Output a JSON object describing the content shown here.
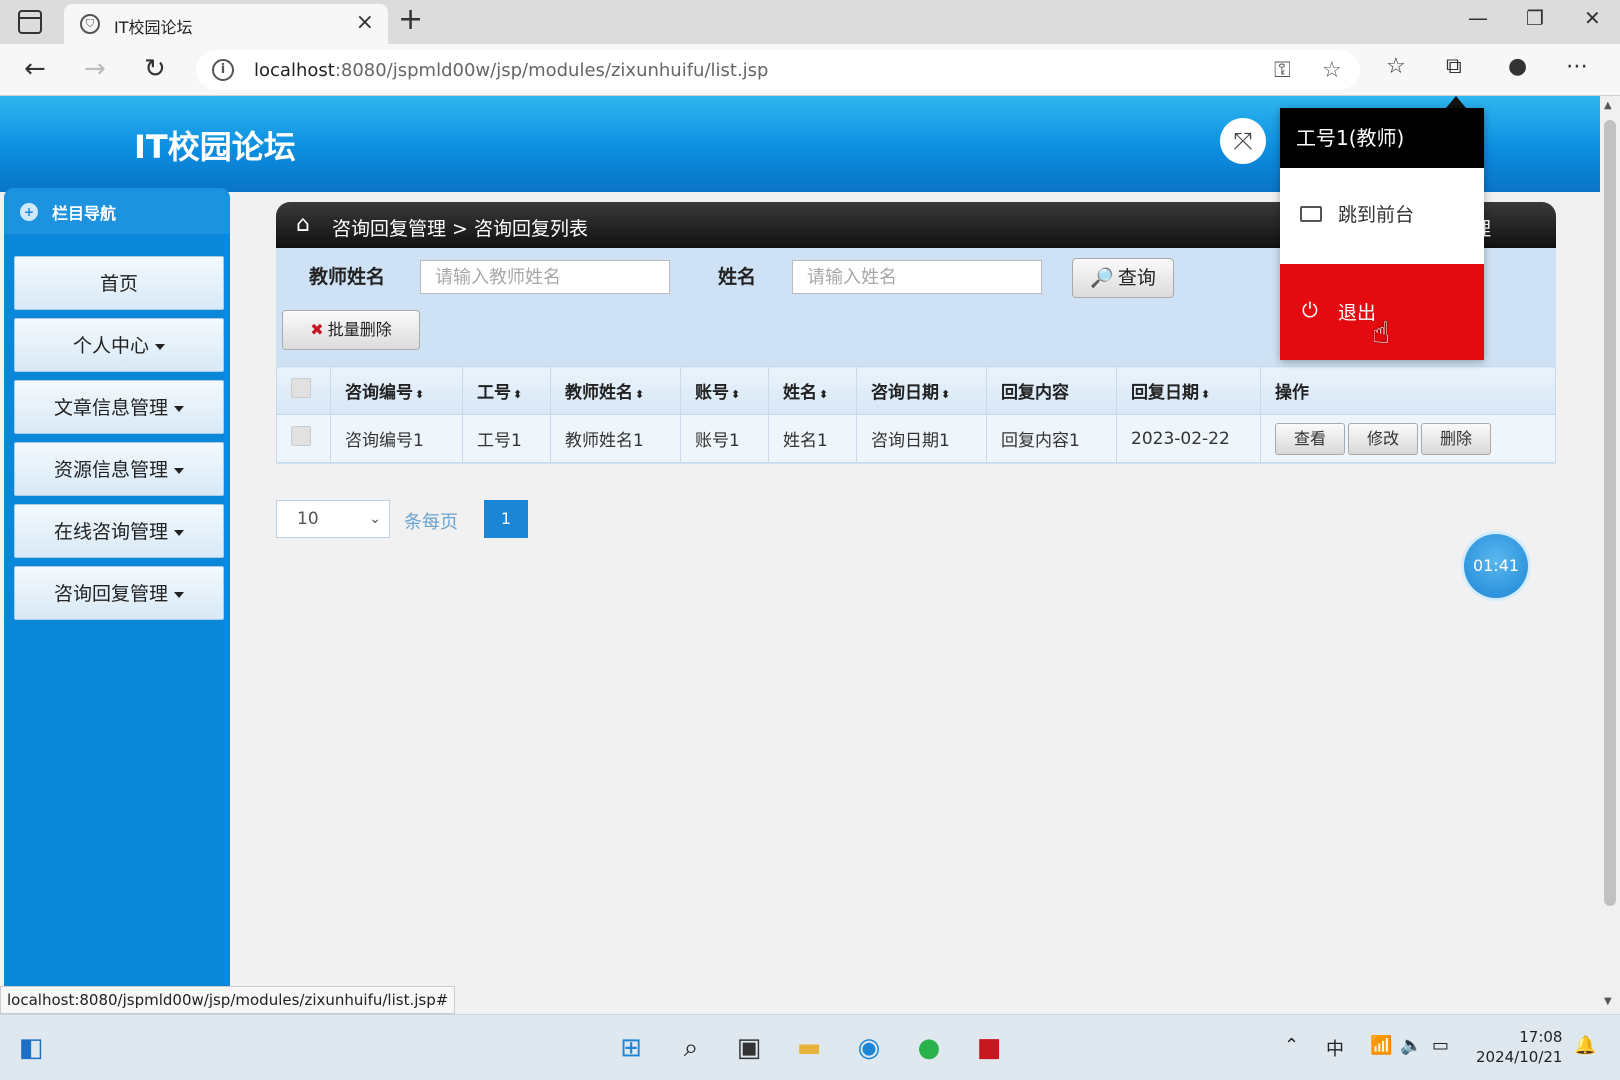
{
  "browser": {
    "tab_title": "IT校园论坛",
    "url_host": "localhost",
    "url_rest": ":8080/jspmld00w/jsp/modules/zixunhuifu/list.jsp",
    "status_url": "localhost:8080/jspmld00w/jsp/modules/zixunhuifu/list.jsp#"
  },
  "app": {
    "title": "IT校园论坛"
  },
  "sidebar": {
    "header": "栏目导航",
    "items": [
      {
        "label": "首页",
        "has_caret": false
      },
      {
        "label": "个人中心",
        "has_caret": true
      },
      {
        "label": "文章信息管理",
        "has_caret": true
      },
      {
        "label": "资源信息管理",
        "has_caret": true
      },
      {
        "label": "在线咨询管理",
        "has_caret": true
      },
      {
        "label": "咨询回复管理",
        "has_caret": true
      }
    ]
  },
  "breadcrumb": {
    "text": "咨询回复管理 > 咨询回复列表",
    "right_text": "理"
  },
  "search": {
    "teacher_label": "教师姓名",
    "teacher_placeholder": "请输入教师姓名",
    "name_label": "姓名",
    "name_placeholder": "请输入姓名",
    "query_button": "查询"
  },
  "batch_delete": "批量删除",
  "table": {
    "headers": [
      "咨询编号",
      "工号",
      "教师姓名",
      "账号",
      "姓名",
      "咨询日期",
      "回复内容",
      "回复日期",
      "操作"
    ],
    "rows": [
      {
        "cells": [
          "咨询编号1",
          "工号1",
          "教师姓名1",
          "账号1",
          "姓名1",
          "咨询日期1",
          "回复内容1",
          "2023-02-22"
        ]
      }
    ],
    "actions": {
      "view": "查看",
      "edit": "修改",
      "delete": "删除"
    }
  },
  "pagination": {
    "page_size": "10",
    "per_page_label": "条每页",
    "current_page": "1"
  },
  "timer": "01:41",
  "user_menu": {
    "user": "工号1(教师)",
    "go_front": "跳到前台",
    "logout": "退出"
  },
  "taskbar": {
    "time": "17:08",
    "date": "2024/10/21",
    "ime": "中"
  },
  "colors": {
    "header_blue": "#0c8ee0",
    "sidebar_blue": "#0b87d9",
    "logout_red": "#e30b10",
    "page_active": "#1c86d6"
  }
}
